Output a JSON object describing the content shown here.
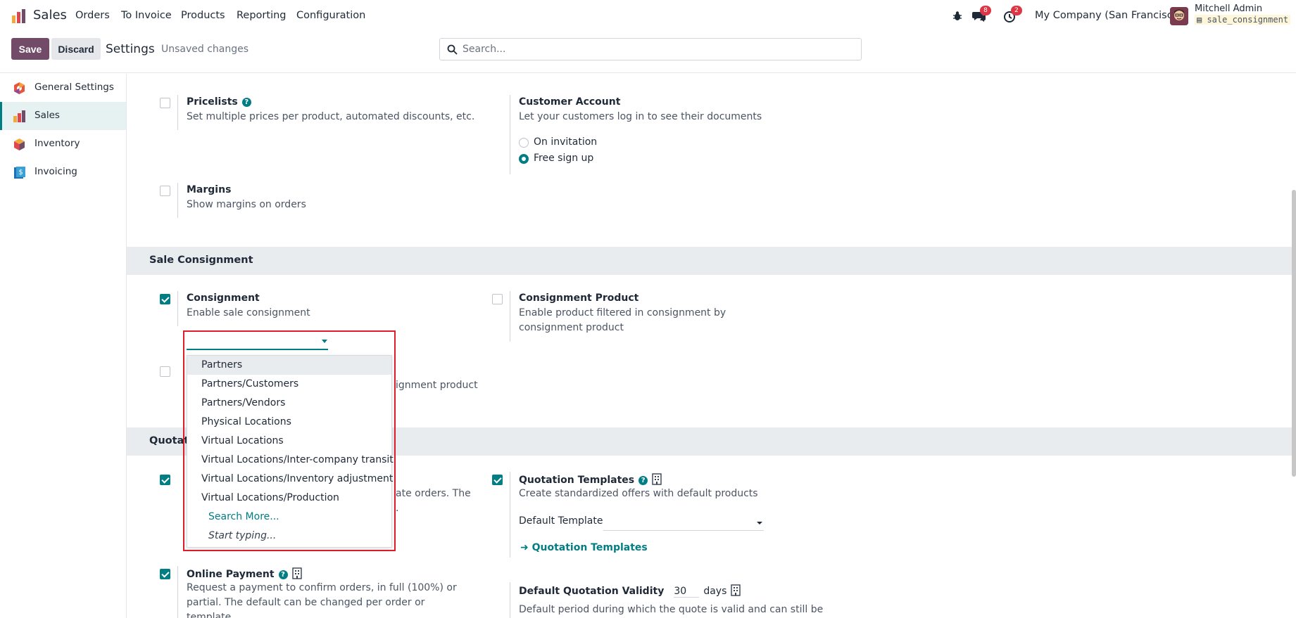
{
  "navbar": {
    "app_name": "Sales",
    "menu": [
      "Orders",
      "To Invoice",
      "Products",
      "Reporting",
      "Configuration"
    ],
    "messages_count": "8",
    "activities_count": "2",
    "company": "My Company (San Francisco)",
    "user_name": "Mitchell Admin",
    "database": "sale_consignment"
  },
  "controlbar": {
    "save_label": "Save",
    "discard_label": "Discard",
    "title": "Settings",
    "status": "Unsaved changes",
    "search_placeholder": "Search..."
  },
  "sidebar": {
    "items": [
      {
        "label": "General Settings",
        "icon": "odoo-settings-icon",
        "active": false
      },
      {
        "label": "Sales",
        "icon": "sales-icon",
        "active": true
      },
      {
        "label": "Inventory",
        "icon": "inventory-icon",
        "active": false
      },
      {
        "label": "Invoicing",
        "icon": "invoicing-icon",
        "active": false
      }
    ]
  },
  "pricing": {
    "pricelists": {
      "title": "Pricelists",
      "desc": "Set multiple prices per product, automated discounts, etc.",
      "checked": false
    },
    "customer_account": {
      "title": "Customer Account",
      "desc": "Let your customers log in to see their documents",
      "options": [
        "On invitation",
        "Free sign up"
      ],
      "selected": "Free sign up"
    },
    "margins": {
      "title": "Margins",
      "desc": "Show margins on orders",
      "checked": false
    }
  },
  "consignment_section": {
    "title": "Sale Consignment",
    "consignment": {
      "title": "Consignment",
      "desc": "Enable sale consignment",
      "checked": true
    },
    "consignment_product": {
      "title": "Consignment Product",
      "desc": "Enable product filtered in consignment by consignment product",
      "checked": false
    },
    "hidden_row_desc_fragment": "ignment product"
  },
  "dropdown": {
    "items": [
      "Partners",
      "Partners/Customers",
      "Partners/Vendors",
      "Physical Locations",
      "Virtual Locations",
      "Virtual Locations/Inter-company transit",
      "Virtual Locations/Inventory adjustment",
      "Virtual Locations/Production"
    ],
    "search_more": "Search More...",
    "start_typing": "Start typing..."
  },
  "quotations_section": {
    "title_fragment": "Quotati",
    "left_desc_fragment_1": "ate orders. The",
    "left_desc_fragment_2": ".",
    "quotation_templates": {
      "title": "Quotation Templates",
      "desc": "Create standardized offers with default products",
      "checked": true,
      "default_template_label": "Default Template",
      "link": "Quotation Templates"
    },
    "online_payment": {
      "title": "Online Payment",
      "desc": "Request a payment to confirm orders, in full (100%) or partial. The default can be changed per order or template.",
      "checked": true
    },
    "validity": {
      "title": "Default Quotation Validity",
      "value": "30",
      "unit": "days",
      "desc": "Default period during which the quote is valid and can still be"
    }
  },
  "colors": {
    "brand": "#714b67",
    "accent": "#017e84",
    "danger": "#dc3545",
    "highlight_frame": "#e11d2a"
  }
}
